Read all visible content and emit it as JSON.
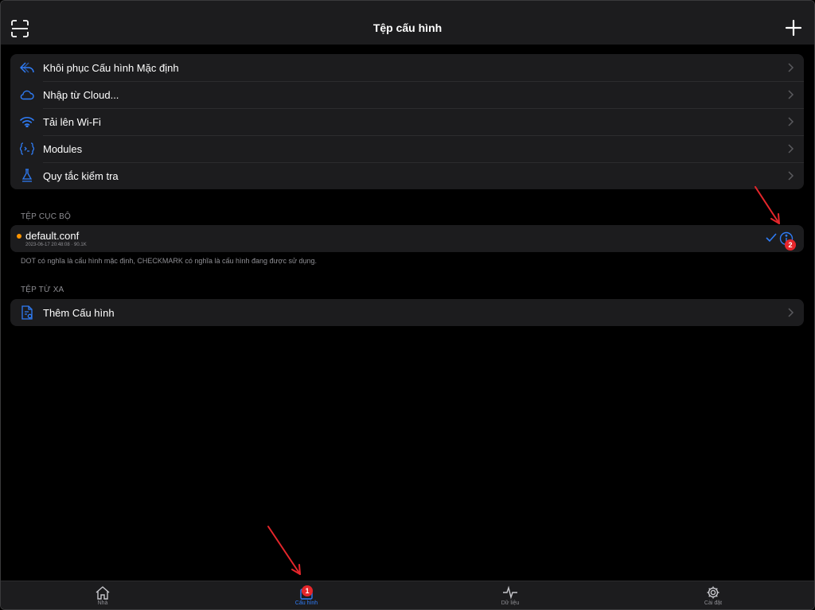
{
  "header": {
    "title": "Tệp cấu hình",
    "left_icon": "scan-icon",
    "right_icon": "plus-icon"
  },
  "actions": [
    {
      "icon": "restore-icon",
      "label": "Khôi phục Cấu hình Mặc định"
    },
    {
      "icon": "cloud-icon",
      "label": "Nhập từ Cloud..."
    },
    {
      "icon": "wifi-icon",
      "label": "Tải lên Wi-Fi"
    },
    {
      "icon": "modules-icon",
      "label": "Modules"
    },
    {
      "icon": "test-rules-icon",
      "label": "Quy tắc kiểm tra"
    }
  ],
  "local_section": {
    "header": "TỆP CỤC BỘ",
    "file": {
      "name": "default.conf",
      "meta": "2023-06-17 20:48:08 · 90.1K"
    },
    "footnote": "DOT có nghĩa là cấu hình mặc định, CHECKMARK có nghĩa là cấu hình đang được sử dụng."
  },
  "remote_section": {
    "header": "TỆP TỪ XA",
    "add_label": "Thêm Cấu hình"
  },
  "annotations": {
    "badge_1": "1",
    "badge_2": "2"
  },
  "tabs": [
    {
      "icon": "home-icon",
      "label": "Nhà"
    },
    {
      "icon": "config-icon",
      "label": "Cấu hình",
      "active": true
    },
    {
      "icon": "data-icon",
      "label": "Dữ liệu"
    },
    {
      "icon": "settings-icon",
      "label": "Cài đặt"
    }
  ],
  "colors": {
    "accent": "#2f7cf6",
    "dot": "#ff9500",
    "badge": "#e5262b",
    "arrow": "#e5262b"
  }
}
